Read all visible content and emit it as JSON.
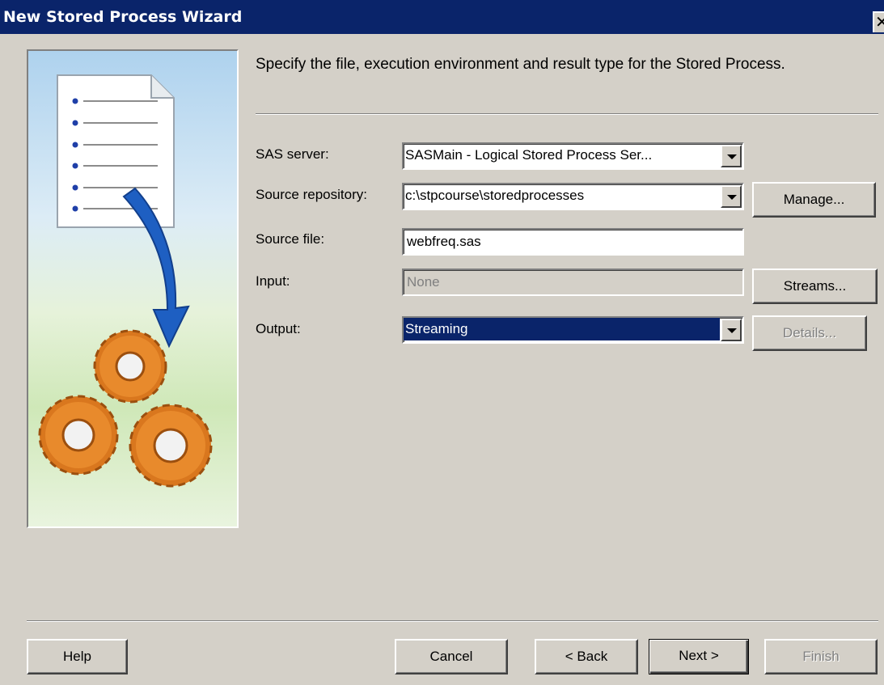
{
  "window": {
    "title": "New Stored Process Wizard",
    "close_glyph": "✕"
  },
  "instruction": "Specify the file, execution environment and result type for the Stored Process.",
  "form": {
    "sas_server": {
      "label": "SAS server:",
      "value": "SASMain - Logical Stored Process Ser..."
    },
    "source_repository": {
      "label": "Source repository:",
      "value": "c:\\stpcourse\\storedprocesses",
      "manage_label": "Manage..."
    },
    "source_file": {
      "label": "Source file:",
      "value": "webfreq.sas"
    },
    "input": {
      "label": "Input:",
      "value": "None",
      "streams_label": "Streams..."
    },
    "output": {
      "label": "Output:",
      "value": "Streaming",
      "details_label": "Details..."
    }
  },
  "footer": {
    "help": "Help",
    "cancel": "Cancel",
    "back": "< Back",
    "next": "Next >",
    "finish": "Finish"
  },
  "colors": {
    "titlebar": "#0a246a",
    "dialog_bg": "#d4d0c8",
    "selection": "#0a246a",
    "disabled_text": "#808080"
  },
  "icons": [
    "close-icon",
    "document-icon",
    "arrow-icon",
    "gears-icon",
    "dropdown-arrow-icon"
  ]
}
